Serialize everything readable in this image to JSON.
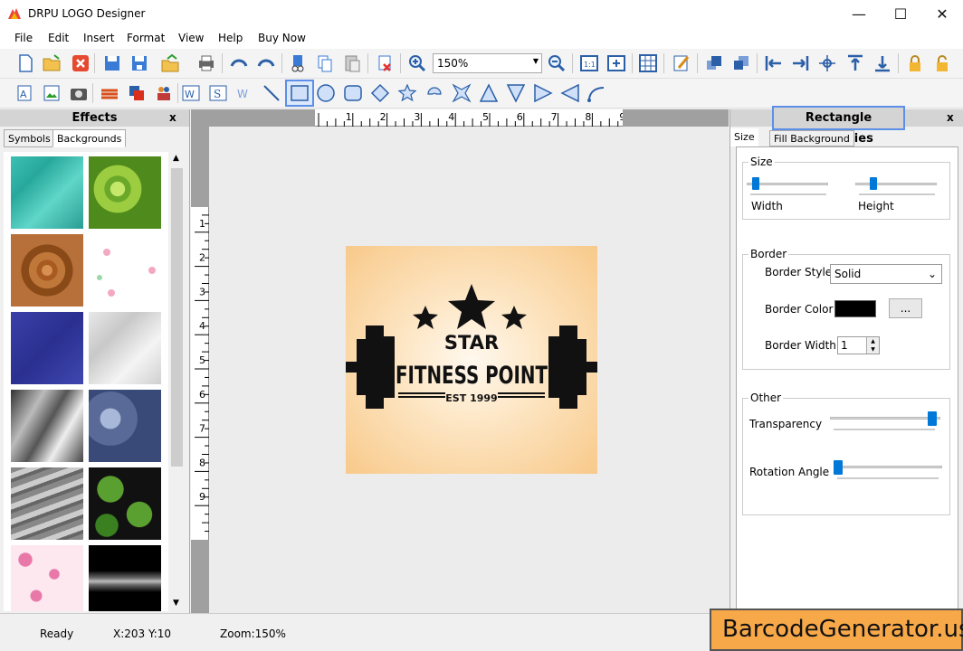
{
  "window": {
    "title": "DRPU LOGO Designer",
    "minimize_icon": "minimize-icon",
    "maximize_icon": "maximize-icon",
    "close_icon": "close-icon"
  },
  "menu": [
    "File",
    "Edit",
    "Insert",
    "Format",
    "View",
    "Help",
    "Buy Now"
  ],
  "toolbar": {
    "zoom_value": "150%"
  },
  "effects_panel": {
    "title": "Effects",
    "close": "x",
    "tabs": [
      "Symbols",
      "Backgrounds"
    ],
    "active_tab": "Backgrounds"
  },
  "logo": {
    "line1": "STAR",
    "line2": "FITNESS POINT",
    "line3": "EST 1999"
  },
  "ruler": {
    "h_ticks": [
      "1",
      "2",
      "3",
      "4",
      "5",
      "6",
      "7",
      "8",
      "9"
    ],
    "v_ticks": [
      "1",
      "2",
      "3",
      "4",
      "5",
      "6",
      "7",
      "8",
      "9"
    ]
  },
  "properties_panel": {
    "title": "Rectangle Properties",
    "close": "x",
    "tabs": [
      "Size",
      "Fill Background"
    ],
    "active_tab": "Size",
    "size_group": {
      "title": "Size",
      "width_label": "Width",
      "height_label": "Height"
    },
    "border_group": {
      "title": "Border",
      "style_label": "Border Style",
      "style_value": "Solid",
      "color_label": "Border Color",
      "color_value": "#000000",
      "color_button": "...",
      "width_label": "Border Width",
      "width_value": "1"
    },
    "other_group": {
      "title": "Other",
      "transparency_label": "Transparency",
      "rotation_label": "Rotation Angle"
    }
  },
  "status": {
    "ready": "Ready",
    "coords": "X:203  Y:10",
    "zoom": "Zoom:150%"
  },
  "watermark": "BarcodeGenerator.us",
  "colors": {
    "accent": "#0078d7",
    "selection": "#5b8fe8",
    "watermark_bg": "#f7a94a"
  }
}
